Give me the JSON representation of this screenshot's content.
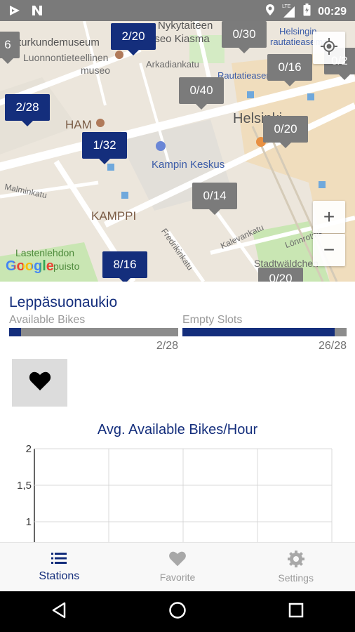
{
  "status_bar": {
    "time": "00:29",
    "network_label": "LTE"
  },
  "map": {
    "labels": {
      "museum1": "Nykytaiteen",
      "museum2": "turkundemuseum",
      "museum2b": "useo Kiasma",
      "museum3": "Luonnontieteellinen",
      "museum4": "museo",
      "helsinki_small": "Helsingin",
      "helsinki_small2": "rautatieasema",
      "arkadiankatu": "Arkadiankatu",
      "rautatieasema2": "Rautatieasema",
      "helsinki": "Helsinki",
      "ham": "HAM",
      "kampin_keskus": "Kampin Keskus",
      "malminkatu": "Malminkatu",
      "kamppi": "KAMPPI",
      "fredrikinkatu": "Fredrikinkatu",
      "kalevankatu": "Kalevankatu",
      "lastenlehdon": "Lastenlehdon",
      "puisto": "puisto",
      "stadtwaldchen": "Stadtwäldchen",
      "lonnrotink": "Lönnrotink",
      "google": "Google"
    },
    "markers": [
      {
        "text": "6",
        "style": "gray"
      },
      {
        "text": "2/20",
        "style": "blue"
      },
      {
        "text": "0/30",
        "style": "gray"
      },
      {
        "text": "0/16",
        "style": "gray"
      },
      {
        "text": "0/2",
        "style": "gray"
      },
      {
        "text": "0/40",
        "style": "gray"
      },
      {
        "text": "2/28",
        "style": "blue"
      },
      {
        "text": "0/20",
        "style": "gray"
      },
      {
        "text": "1/32",
        "style": "blue"
      },
      {
        "text": "0/14",
        "style": "gray"
      },
      {
        "text": "8/16",
        "style": "blue"
      },
      {
        "text": "0/20",
        "style": "gray"
      }
    ],
    "zoom_in_label": "+",
    "zoom_out_label": "−"
  },
  "station": {
    "name": "Leppäsuonaukio",
    "available_bikes_label": "Available Bikes",
    "available_bikes_value": "2/28",
    "available_bikes_fraction": 0.0714,
    "empty_slots_label": "Empty Slots",
    "empty_slots_value": "26/28",
    "empty_slots_fraction": 0.9286
  },
  "chart_data": {
    "type": "line",
    "title": "Avg. Available Bikes/Hour",
    "y_tick_labels": [
      "2",
      "1,5",
      "1"
    ],
    "ylim": [
      1,
      2
    ],
    "grid": true,
    "series": []
  },
  "bottom_nav": {
    "items": [
      {
        "label": "Stations",
        "icon": "list-icon",
        "active": true
      },
      {
        "label": "Favorite",
        "icon": "heart-icon",
        "active": false
      },
      {
        "label": "Settings",
        "icon": "gear-icon",
        "active": false
      }
    ]
  },
  "colors": {
    "accent": "#142e7c",
    "marker_gray": "#7b7b7b",
    "bar_track": "#8c8c8c",
    "status_bar": "#7a7a7a"
  }
}
